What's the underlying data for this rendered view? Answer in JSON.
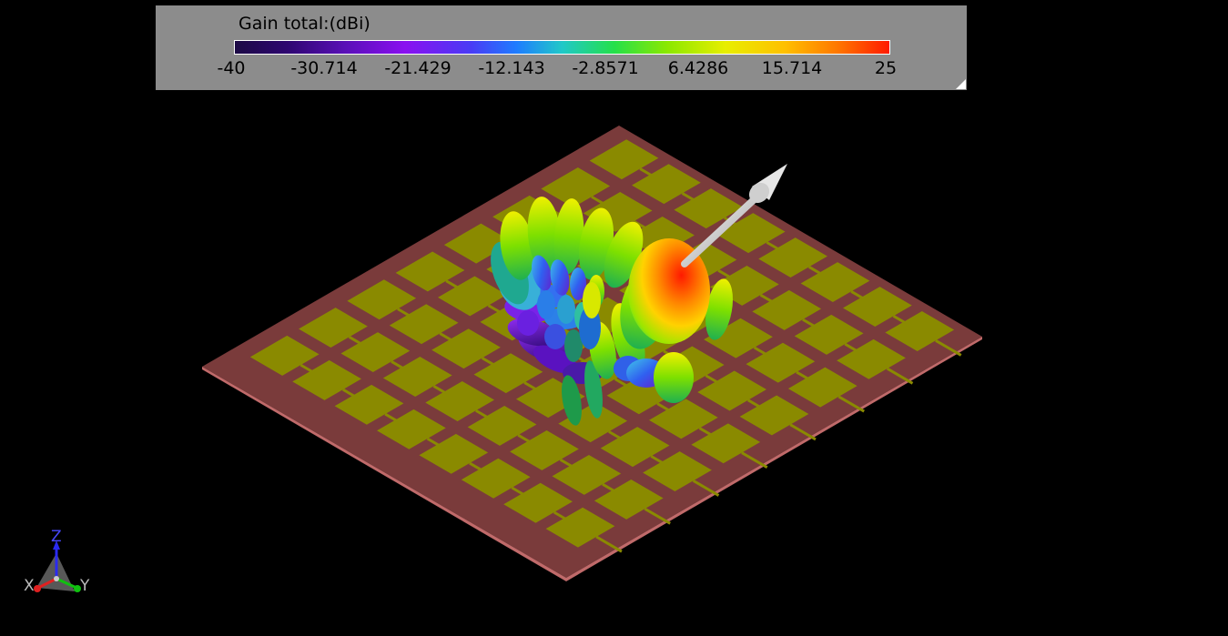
{
  "legend": {
    "title": "Gain total:(dBi)",
    "ticks": [
      "-40",
      "-30.714",
      "-21.429",
      "-12.143",
      "-2.8571",
      "6.4286",
      "15.714",
      "25"
    ]
  },
  "axes": {
    "z": "Z",
    "x": "X",
    "y": "Y"
  },
  "colors": {
    "background": "#000000",
    "panel": "#8c8c8c",
    "substrate": "#7a3b3b",
    "patch": "#8a8a00",
    "main_lobe": "#ff3a10"
  },
  "icons": {
    "axis_triad": "xyz-axis-icon",
    "resize": "resize-corner-icon"
  }
}
